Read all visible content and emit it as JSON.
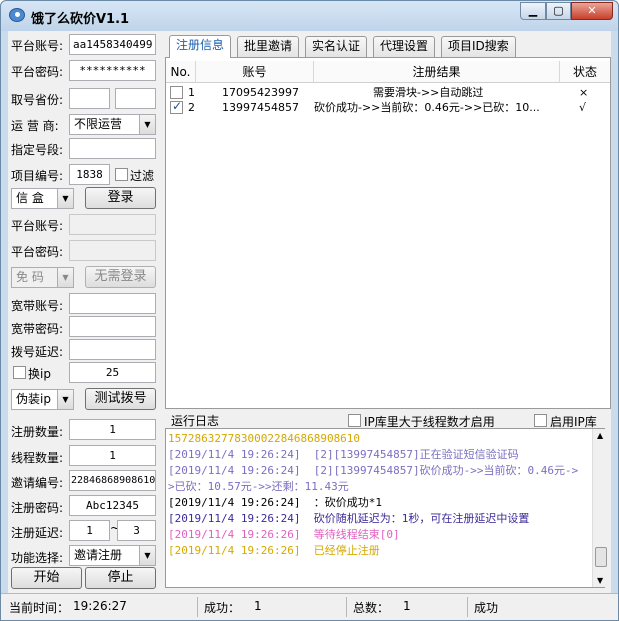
{
  "window": {
    "title": "饿了么砍价V1.1",
    "min": "0",
    "max": "1",
    "close": "r"
  },
  "left": {
    "platform_account_label": "平台账号:",
    "platform_account_value": "aa1458340499",
    "platform_password_label": "平台密码:",
    "platform_password_value": "**********",
    "province_label": "取号省份:",
    "province_value1": "",
    "province_value2": "",
    "operator_label": "运 营 商:",
    "operator_value": "不限运营",
    "segment_label": "指定号段:",
    "segment_value": "",
    "project_label": "项目编号:",
    "project_value": "1838",
    "filter_label": "过滤",
    "box_select": "信  盒",
    "login_button": "登录",
    "p2_account_label": "平台账号:",
    "p2_password_label": "平台密码:",
    "captcha_select": "免  码",
    "no_login_button": "无需登录",
    "bb_account_label": "宽带账号:",
    "bb_password_label": "宽带密码:",
    "dial_delay_label": "拨号延迟:",
    "change_ip_label": "换ip",
    "change_ip_value": "25",
    "fake_ip_select": "伪装ip",
    "test_dial_button": "测试拨号",
    "reg_count_label": "注册数量:",
    "reg_count_value": "1",
    "thread_count_label": "线程数量:",
    "thread_count_value": "1",
    "invite_label": "邀请编号:",
    "invite_value": "22846868908610",
    "reg_password_label": "注册密码:",
    "reg_password_value": "Abc12345",
    "reg_delay_label": "注册延迟:",
    "reg_delay_from": "1",
    "reg_delay_sep": "~",
    "reg_delay_to": "3",
    "func_label": "功能选择:",
    "func_value": "邀请注册",
    "start_button": "开始",
    "stop_button": "停止"
  },
  "tabs": [
    "注册信息",
    "批里邀请",
    "实名认证",
    "代理设置",
    "项目ID搜索"
  ],
  "grid": {
    "headers": [
      "No.",
      "账号",
      "注册结果",
      "状态"
    ],
    "rows": [
      {
        "checked": false,
        "no": "1",
        "account": "17095423997",
        "result": "需要滑块->>自动跳过",
        "status": "×"
      },
      {
        "checked": true,
        "no": "2",
        "account": "13997454857",
        "result": "砍价成功->>当前砍：0.46元->>已砍：10...",
        "status": "√"
      }
    ]
  },
  "log": {
    "title": "运行日志",
    "opt1": "IP库里大于线程数才启用",
    "opt2": "启用IP库",
    "lines": [
      {
        "text": "157286327783000228468689086​10",
        "color": "#d4a800"
      },
      {
        "text": "[2019/11/4 19:26:24]  [2][13997454857]正在验证短信验证码",
        "color": "#7a6fc0"
      },
      {
        "text": "[2019/11/4 19:26:24]  [2][13997454857]砍价成功->>当前砍：0.46元->>已砍：10.57元->>还剩：11.43元",
        "color": "#7a6fc0"
      },
      {
        "text": "[2019/11/4 19:26:24]  ：砍价成功*1",
        "color": "#000000"
      },
      {
        "text": "[2019/11/4 19:26:24]  砍价随机延迟为：1秒，可在注册延迟中设置",
        "color": "#3b2a9a"
      },
      {
        "text": "[2019/11/4 19:26:26]  等待线程结束[0]",
        "color": "#e060c0"
      },
      {
        "text": "[2019/11/4 19:26:26]  已经停止注册",
        "color": "#d4a800"
      }
    ]
  },
  "status": {
    "time_label": "当前时间：",
    "time_value": "19:26:27",
    "success_label": "成功：",
    "success_value": "1",
    "total_label": "总数：",
    "total_value": "1",
    "success2_label": "成功"
  }
}
